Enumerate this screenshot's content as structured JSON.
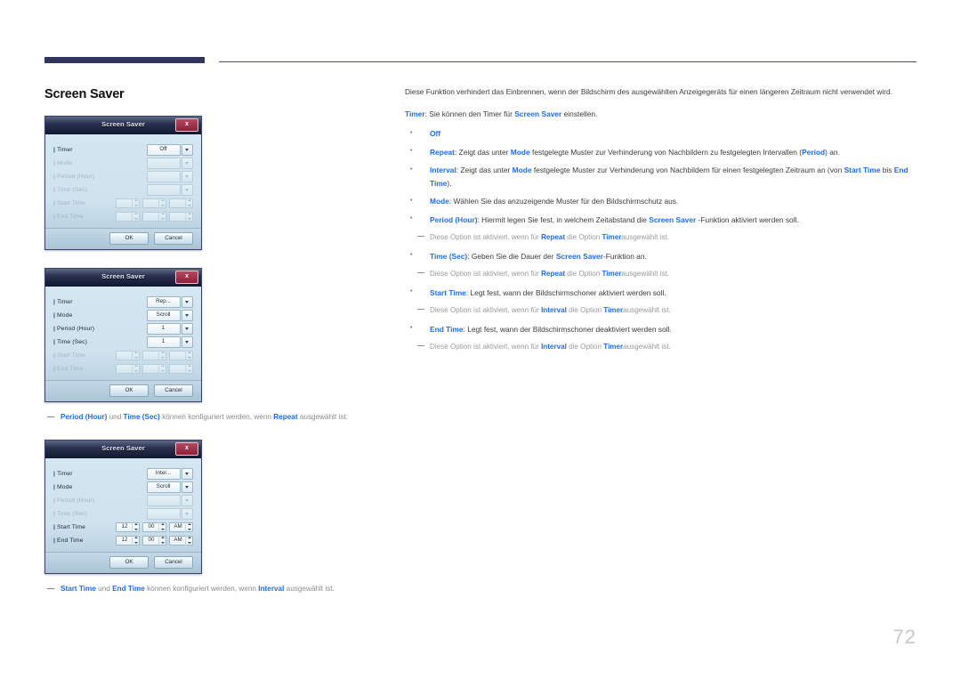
{
  "page": {
    "title": "Screen Saver",
    "number": "72",
    "accent_blue": "#1a6ff0",
    "rule_color": "#32355c"
  },
  "dialogs": [
    {
      "title": "Screen Saver",
      "close_label": "x",
      "rows": [
        {
          "label": "Timer",
          "value": "Off",
          "type": "combo",
          "enabled": true
        },
        {
          "label": "Mode",
          "value": "",
          "type": "combo",
          "enabled": false
        },
        {
          "label": "Period (Hour)",
          "value": "",
          "type": "combo",
          "enabled": false
        },
        {
          "label": "Time (Sec)",
          "value": "",
          "type": "combo",
          "enabled": false
        },
        {
          "label": "Start Time",
          "type": "time",
          "enabled": false,
          "time": [
            "",
            "",
            ""
          ]
        },
        {
          "label": "End Time",
          "type": "time",
          "enabled": false,
          "time": [
            "",
            "",
            ""
          ]
        }
      ],
      "ok_label": "OK",
      "cancel_label": "Cancel"
    },
    {
      "title": "Screen Saver",
      "close_label": "x",
      "rows": [
        {
          "label": "Timer",
          "value": "Rep...",
          "type": "combo",
          "enabled": true
        },
        {
          "label": "Mode",
          "value": "Scroll",
          "type": "combo",
          "enabled": true
        },
        {
          "label": "Period (Hour)",
          "value": "1",
          "type": "combo",
          "enabled": true
        },
        {
          "label": "Time (Sec)",
          "value": "1",
          "type": "combo",
          "enabled": true
        },
        {
          "label": "Start Time",
          "type": "time",
          "enabled": false,
          "time": [
            "",
            "",
            ""
          ]
        },
        {
          "label": "End Time",
          "type": "time",
          "enabled": false,
          "time": [
            "",
            "",
            ""
          ]
        }
      ],
      "ok_label": "OK",
      "cancel_label": "Cancel"
    },
    {
      "title": "Screen Saver",
      "close_label": "x",
      "rows": [
        {
          "label": "Timer",
          "value": "Inter...",
          "type": "combo",
          "enabled": true
        },
        {
          "label": "Mode",
          "value": "Scroll",
          "type": "combo",
          "enabled": true
        },
        {
          "label": "Period (Hour)",
          "value": "",
          "type": "combo",
          "enabled": false
        },
        {
          "label": "Time (Sec)",
          "value": "",
          "type": "combo",
          "enabled": false
        },
        {
          "label": "Start Time",
          "type": "time",
          "enabled": true,
          "time": [
            "12",
            "00",
            "AM"
          ]
        },
        {
          "label": "End Time",
          "type": "time",
          "enabled": true,
          "time": [
            "12",
            "00",
            "AM"
          ]
        }
      ],
      "ok_label": "OK",
      "cancel_label": "Cancel"
    }
  ],
  "figure_notes": [
    {
      "dash": "—",
      "parts": [
        {
          "text": "Period (Hour)",
          "bold": true
        },
        {
          "text": " und ",
          "bold": false
        },
        {
          "text": "Time (Sec)",
          "bold": true
        },
        {
          "text": " können konfiguriert werden, wenn ",
          "bold": false
        },
        {
          "text": "Repeat",
          "bold": true
        },
        {
          "text": " ausgewählt ist.",
          "bold": false
        }
      ]
    },
    {
      "dash": "—",
      "parts": [
        {
          "text": "Start Time",
          "bold": true
        },
        {
          "text": " und ",
          "bold": false
        },
        {
          "text": "End Time",
          "bold": true
        },
        {
          "text": " können konfiguriert werden, wenn ",
          "bold": false
        },
        {
          "text": "Interval",
          "bold": true
        },
        {
          "text": " ausgewählt ist.",
          "bold": false
        }
      ]
    }
  ],
  "body": {
    "intro": "Diese Funktion verhindert das Einbrennen, wenn der Bildschirm des ausgewählten Anzeigegeräts für einen längeren Zeitraum nicht verwendet wird.",
    "lead": [
      {
        "text": "Timer",
        "bold": true
      },
      {
        "text": ": Sie können den Timer für ",
        "bold": false
      },
      {
        "text": "Screen Saver",
        "bold": true
      },
      {
        "text": " einstellen.",
        "bold": false
      }
    ],
    "items": [
      {
        "kind": "bullet",
        "parts": [
          {
            "text": "Off",
            "bold": true
          }
        ]
      },
      {
        "kind": "bullet",
        "parts": [
          {
            "text": "Repeat",
            "bold": true
          },
          {
            "text": ": Zeigt das unter ",
            "bold": false
          },
          {
            "text": "Mode",
            "bold": true
          },
          {
            "text": " festgelegte Muster zur Verhinderung von Nachbildern zu festgelegten Intervallen (",
            "bold": false
          },
          {
            "text": "Period",
            "bold": true
          },
          {
            "text": ") an.",
            "bold": false
          }
        ]
      },
      {
        "kind": "bullet",
        "parts": [
          {
            "text": "Interval",
            "bold": true
          },
          {
            "text": ": Zeigt das unter ",
            "bold": false
          },
          {
            "text": "Mode",
            "bold": true
          },
          {
            "text": " festgelegte Muster zur Verhinderung von Nachbildern für einen festgelegten Zeitraum an (von ",
            "bold": false
          },
          {
            "text": "Start Time",
            "bold": true
          },
          {
            "text": " bis ",
            "bold": false
          },
          {
            "text": "End Time",
            "bold": true
          },
          {
            "text": ").",
            "bold": false
          }
        ]
      },
      {
        "kind": "bullet",
        "parts": [
          {
            "text": "Mode",
            "bold": true
          },
          {
            "text": ": Wählen Sie das anzuzeigende Muster für den Bildschirmschutz aus.",
            "bold": false
          }
        ]
      },
      {
        "kind": "bullet",
        "parts": [
          {
            "text": "Period (Hour)",
            "bold": true
          },
          {
            "text": ": Hiermit legen Sie fest, in welchem Zeitabstand die ",
            "bold": false
          },
          {
            "text": "Screen Saver",
            "bold": true
          },
          {
            "text": " -Funktion aktiviert werden soll.",
            "bold": false
          }
        ]
      },
      {
        "kind": "note",
        "dash": "—",
        "parts": [
          {
            "text": "Diese Option ist aktiviert, wenn für ",
            "bold": false
          },
          {
            "text": "Repeat",
            "bold": true
          },
          {
            "text": " die Option ",
            "bold": false
          },
          {
            "text": "Timer",
            "bold": true
          },
          {
            "text": "ausgewählt ist.",
            "bold": false
          }
        ]
      },
      {
        "kind": "bullet",
        "parts": [
          {
            "text": "Time (Sec)",
            "bold": true
          },
          {
            "text": ": Geben Sie die Dauer der ",
            "bold": false
          },
          {
            "text": "Screen Saver",
            "bold": true
          },
          {
            "text": "-Funktion an.",
            "bold": false
          }
        ]
      },
      {
        "kind": "note",
        "dash": "—",
        "parts": [
          {
            "text": "Diese Option ist aktiviert, wenn für ",
            "bold": false
          },
          {
            "text": "Repeat",
            "bold": true
          },
          {
            "text": " die Option ",
            "bold": false
          },
          {
            "text": "Timer",
            "bold": true
          },
          {
            "text": "ausgewählt ist.",
            "bold": false
          }
        ]
      },
      {
        "kind": "bullet",
        "parts": [
          {
            "text": "Start Time",
            "bold": true
          },
          {
            "text": ": Legt fest, wann der Bildschirmschoner aktiviert werden soll.",
            "bold": false
          }
        ]
      },
      {
        "kind": "note",
        "dash": "—",
        "parts": [
          {
            "text": "Diese Option ist aktiviert, wenn für ",
            "bold": false
          },
          {
            "text": "Interval",
            "bold": true
          },
          {
            "text": " die Option ",
            "bold": false
          },
          {
            "text": "Timer",
            "bold": true
          },
          {
            "text": "ausgewählt ist.",
            "bold": false
          }
        ]
      },
      {
        "kind": "bullet",
        "parts": [
          {
            "text": "End Time",
            "bold": true
          },
          {
            "text": ": Legt fest, wann der Bildschirmschoner deaktiviert werden soll.",
            "bold": false
          }
        ]
      },
      {
        "kind": "note",
        "dash": "—",
        "parts": [
          {
            "text": "Diese Option ist aktiviert, wenn für ",
            "bold": false
          },
          {
            "text": "Interval",
            "bold": true
          },
          {
            "text": " die Option ",
            "bold": false
          },
          {
            "text": "Timer",
            "bold": true
          },
          {
            "text": "ausgewählt ist.",
            "bold": false
          }
        ]
      }
    ]
  }
}
